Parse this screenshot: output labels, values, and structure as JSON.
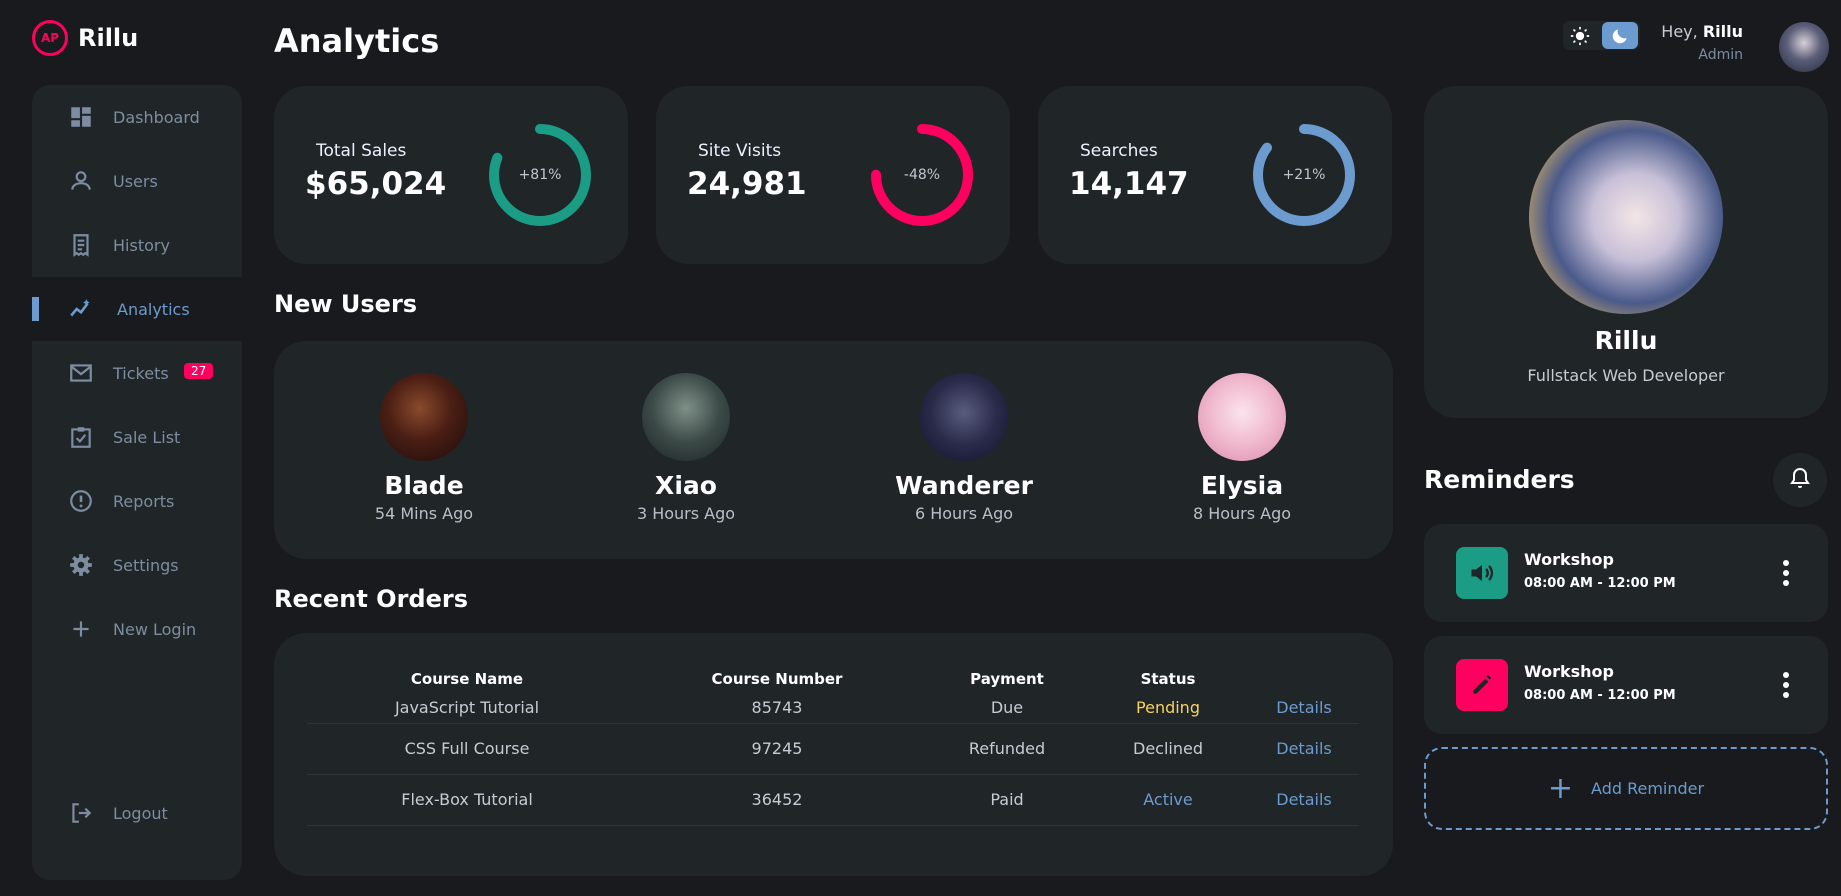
{
  "brand": {
    "name": "Rillu",
    "mark": "AP"
  },
  "sidebar": {
    "items": [
      {
        "label": "Dashboard",
        "icon": "dashboard-icon"
      },
      {
        "label": "Users",
        "icon": "user-icon"
      },
      {
        "label": "History",
        "icon": "receipt-icon"
      },
      {
        "label": "Analytics",
        "icon": "insights-icon",
        "active": true
      },
      {
        "label": "Tickets",
        "icon": "mail-icon",
        "badge": "27"
      },
      {
        "label": "Sale List",
        "icon": "inventory-icon"
      },
      {
        "label": "Reports",
        "icon": "report-icon"
      },
      {
        "label": "Settings",
        "icon": "gear-icon"
      },
      {
        "label": "New Login",
        "icon": "plus-icon"
      }
    ],
    "logout": {
      "label": "Logout",
      "icon": "logout-icon"
    }
  },
  "page": {
    "title": "Analytics"
  },
  "stats": [
    {
      "label": "Total Sales",
      "value": "$65,024",
      "percent": "+81%",
      "progress": 0.81,
      "color": "#1b9c85"
    },
    {
      "label": "Site Visits",
      "value": "24,981",
      "percent": "-48%",
      "progress": 0.75,
      "color": "#ff0060"
    },
    {
      "label": "Searches",
      "value": "14,147",
      "percent": "+21%",
      "progress": 0.85,
      "color": "#6c9bcf"
    }
  ],
  "new_users": {
    "title": "New Users",
    "users": [
      {
        "name": "Blade",
        "time": "54 Mins Ago"
      },
      {
        "name": "Xiao",
        "time": "3 Hours Ago"
      },
      {
        "name": "Wanderer",
        "time": "6 Hours Ago"
      },
      {
        "name": "Elysia",
        "time": "8 Hours Ago"
      }
    ]
  },
  "orders": {
    "title": "Recent Orders",
    "headers": [
      "Course Name",
      "Course Number",
      "Payment",
      "Status"
    ],
    "rows": [
      {
        "course": "JavaScript Tutorial",
        "number": "85743",
        "payment": "Due",
        "status": "Pending",
        "details": "Details"
      },
      {
        "course": "CSS Full Course",
        "number": "97245",
        "payment": "Refunded",
        "status": "Declined",
        "details": "Details"
      },
      {
        "course": "Flex-Box Tutorial",
        "number": "36452",
        "payment": "Paid",
        "status": "Active",
        "details": "Details"
      }
    ]
  },
  "header": {
    "greeting": "Hey,",
    "user": "Rillu",
    "role": "Admin",
    "theme": "dark"
  },
  "profile": {
    "name": "Rillu",
    "role": "Fullstack Web Developer"
  },
  "reminders": {
    "title": "Reminders",
    "items": [
      {
        "name": "Workshop",
        "time": "08:00 AM - 12:00 PM",
        "icon": "volume-icon",
        "color": "#1b9c85"
      },
      {
        "name": "Workshop",
        "time": "08:00 AM - 12:00 PM",
        "icon": "edit-icon",
        "color": "#ff0060"
      }
    ],
    "add_label": "Add Reminder"
  },
  "colors": {
    "primary": "#6c9bcf",
    "danger": "#ff0060",
    "success": "#1b9c85",
    "warning": "#f7d060"
  }
}
